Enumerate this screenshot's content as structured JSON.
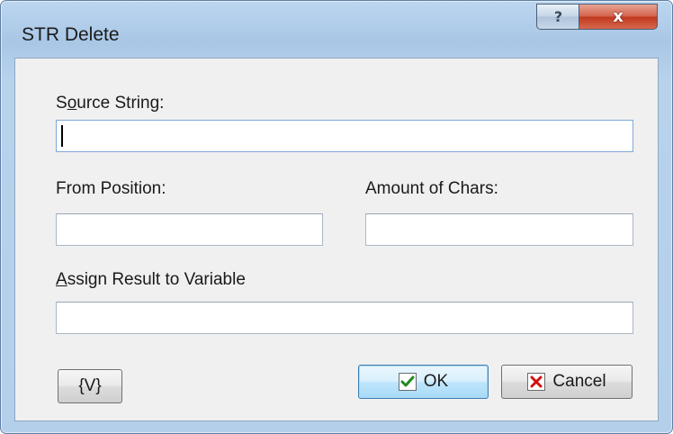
{
  "window": {
    "title": "STR Delete",
    "help_label": "?",
    "close_label": "x"
  },
  "form": {
    "source_string": {
      "label_pre": "S",
      "label_access": "o",
      "label_post": "urce String:",
      "value": ""
    },
    "from_position": {
      "label": "From Position:",
      "value": ""
    },
    "amount_of_chars": {
      "label": "Amount of Chars:",
      "value": ""
    },
    "assign_result": {
      "label_access": "A",
      "label_post": "ssign Result to Variable",
      "value": ""
    }
  },
  "buttons": {
    "variables_label": "{V}",
    "ok_label": "OK",
    "cancel_label": "Cancel"
  },
  "colors": {
    "ok_check": "#1f8a1f",
    "cancel_x": "#d01010"
  }
}
